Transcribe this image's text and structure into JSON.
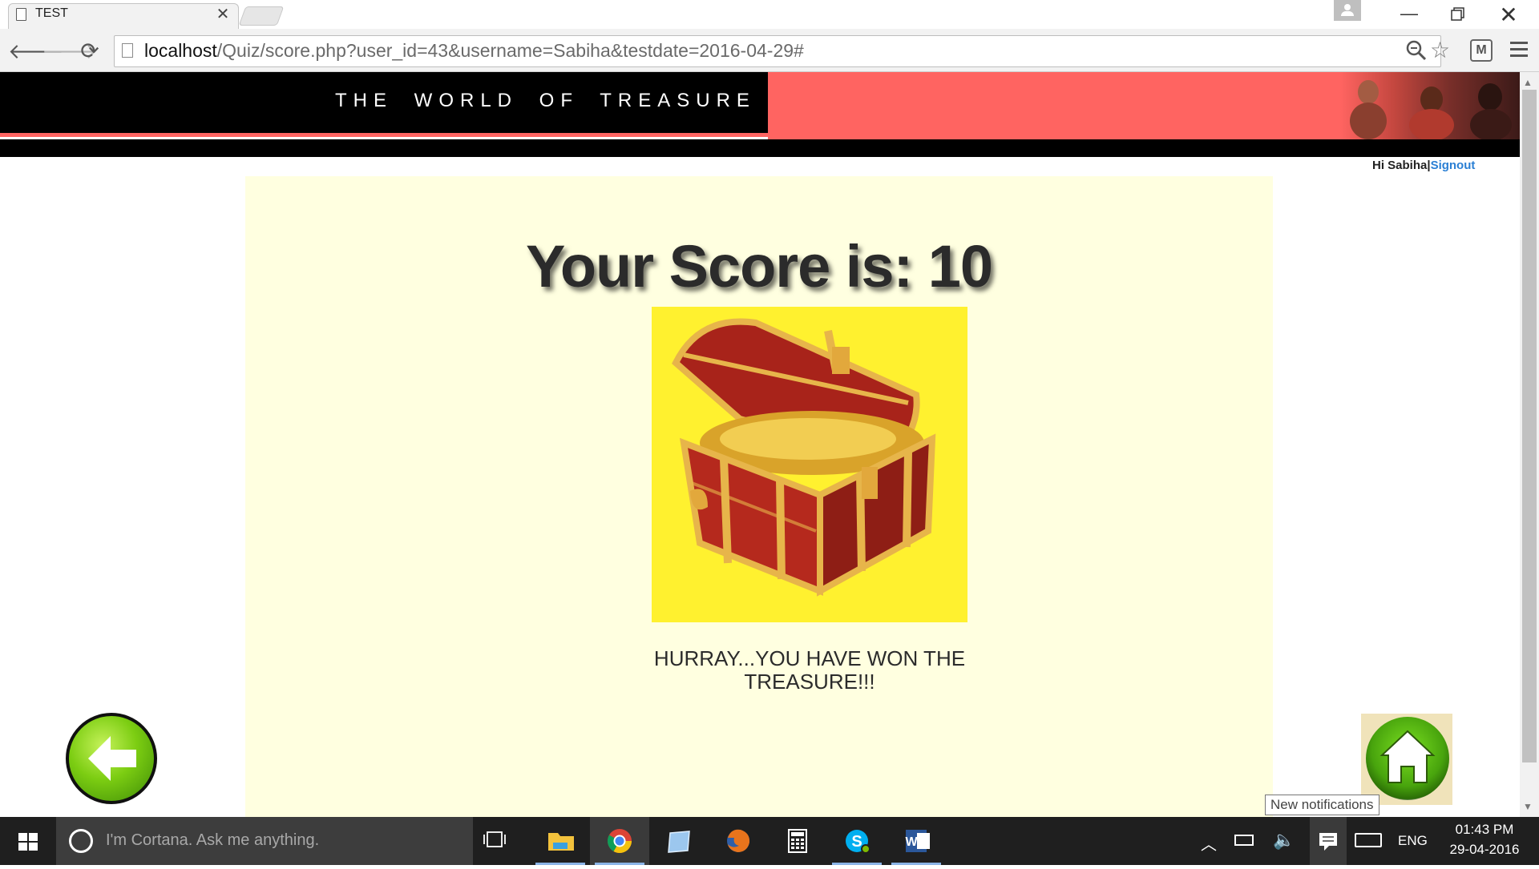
{
  "browser": {
    "tab_title": "TEST",
    "url_host": "localhost",
    "url_rest": "/Quiz/score.php?user_id=43&username=Sabiha&testdate=2016-04-29#"
  },
  "banner": {
    "title": "THE WORLD OF TREASURE"
  },
  "user": {
    "greeting": "Hi Sabiha",
    "separator": "|",
    "signout_label": "Signout"
  },
  "score": {
    "heading": "Your Score is: 10",
    "message": "HURRAY...YOU HAVE WON THE TREASURE!!!"
  },
  "tooltip": {
    "text": "New notifications"
  },
  "taskbar": {
    "cortana_placeholder": "I'm Cortana. Ask me anything.",
    "language": "ENG",
    "time": "01:43 PM",
    "date": "29-04-2016",
    "apps": [
      "file-explorer",
      "chrome",
      "notepad",
      "firefox",
      "calculator",
      "skype",
      "word"
    ]
  },
  "colors": {
    "banner_accent": "#ff6461",
    "panel_background": "#ffffe0",
    "chest_background": "#fff12f",
    "link": "#2a7fd4",
    "taskbar": "#1f1f1f"
  }
}
